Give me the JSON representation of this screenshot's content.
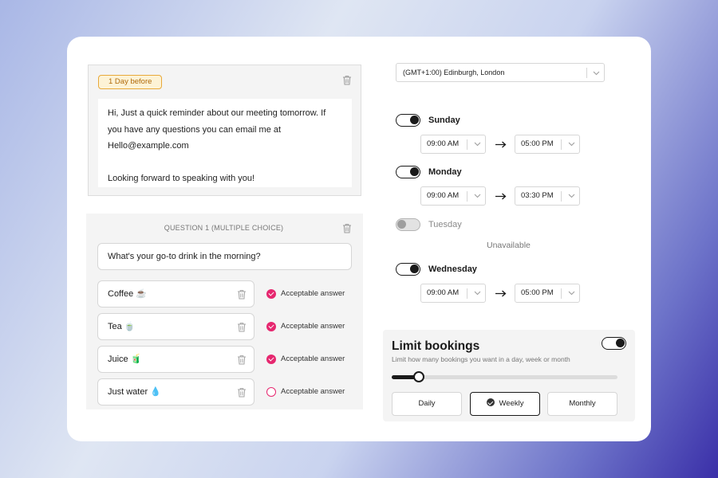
{
  "reminder": {
    "badge": "1 Day before",
    "message_lines": [
      "Hi, Just a quick reminder about our meeting tomorrow. If",
      "you have any questions you can email me at",
      "Hello@example.com",
      "Looking forward to speaking with you!"
    ],
    "delete_icon": "trash-icon"
  },
  "question": {
    "title": "QUESTION 1 (MULTIPLE CHOICE)",
    "prompt": "What's your go-to drink in the morning?",
    "accept_label": "Acceptable answer",
    "answers": [
      {
        "label": "Coffee ☕",
        "acceptable": true
      },
      {
        "label": "Tea 🍵",
        "acceptable": true
      },
      {
        "label": "Juice 🧃",
        "acceptable": true
      },
      {
        "label": "Just water 💧",
        "acceptable": false
      }
    ],
    "accent_color": "#e6276f"
  },
  "timezone": {
    "value": "(GMT+1:00) Edinburgh, London"
  },
  "schedule": {
    "unavailable_label": "Unavailable",
    "days": [
      {
        "name": "Sunday",
        "enabled": true,
        "start": "09:00 AM",
        "end": "05:00 PM"
      },
      {
        "name": "Monday",
        "enabled": true,
        "start": "09:00 AM",
        "end": "03:30 PM"
      },
      {
        "name": "Tuesday",
        "enabled": false
      },
      {
        "name": "Wednesday",
        "enabled": true,
        "start": "09:00 AM",
        "end": "05:00 PM"
      }
    ]
  },
  "limit": {
    "title": "Limit bookings",
    "subtitle": "Limit how many bookings you want in a day, week or month",
    "enabled": true,
    "slider_fraction": 0.12,
    "options": [
      "Daily",
      "Weekly",
      "Monthly"
    ],
    "selected": "Weekly"
  }
}
